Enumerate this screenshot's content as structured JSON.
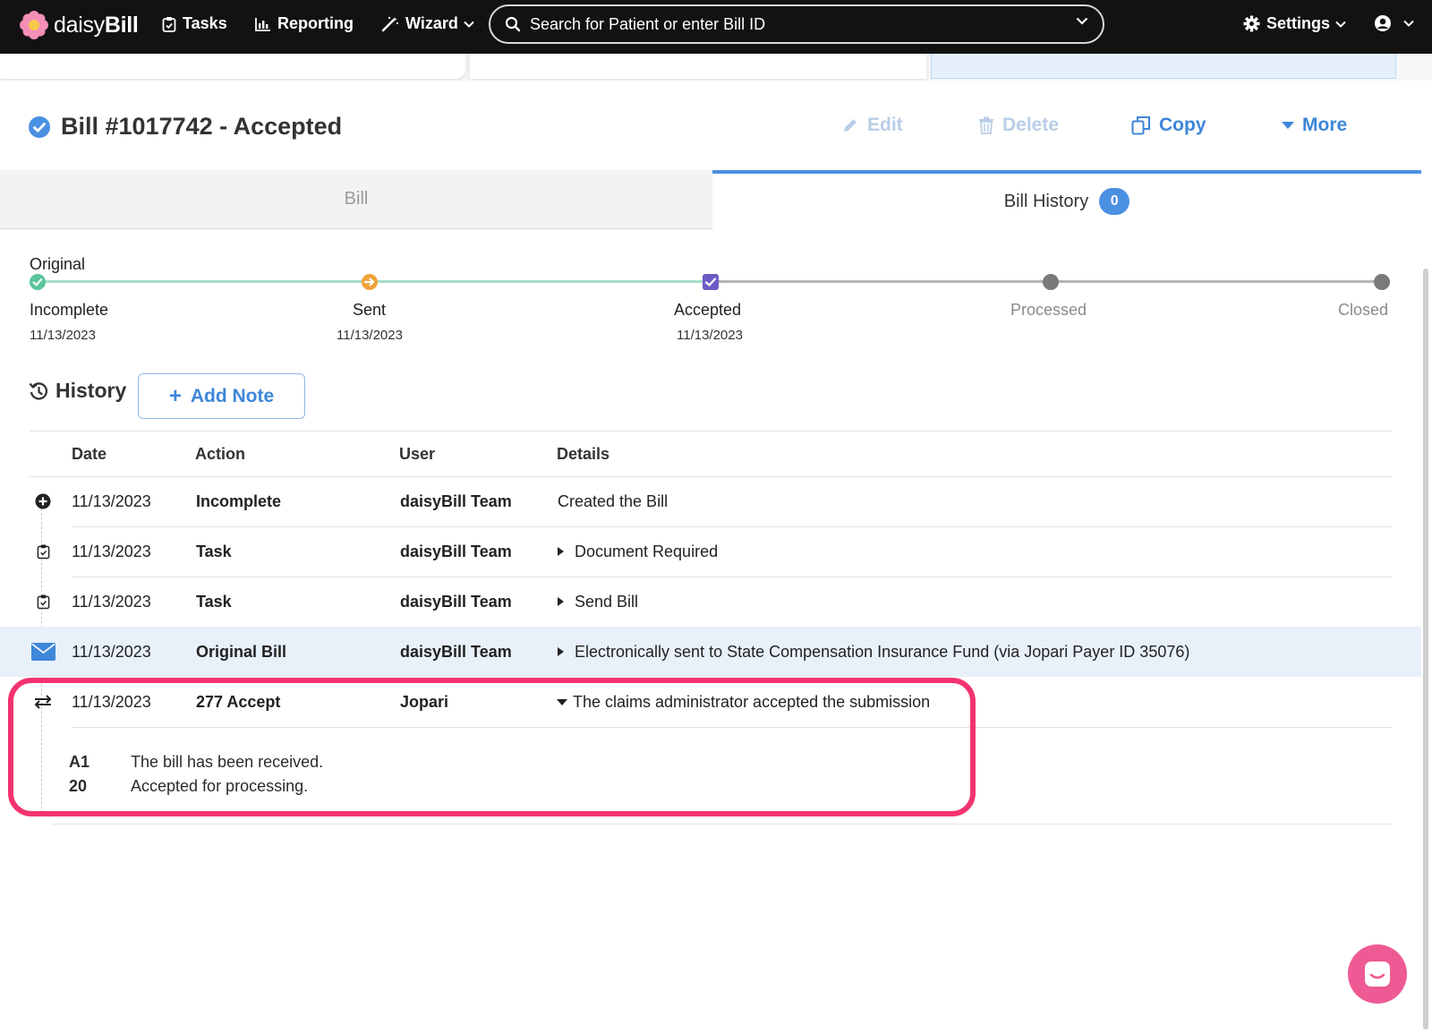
{
  "app": {
    "brand_light": "daisy",
    "brand_bold": "Bill",
    "colors": {
      "accent": "#4a90e2",
      "highlight": "#f3336f",
      "chat": "#ee5a93",
      "progress_done": "#a8dcc6",
      "progress_todo": "#b5b5b5"
    }
  },
  "nav": {
    "tasks": "Tasks",
    "reporting": "Reporting",
    "wizard": "Wizard",
    "search_placeholder": "Search for Patient or enter Bill ID",
    "settings": "Settings"
  },
  "bill": {
    "title": "Bill #1017742 - Accepted",
    "actions": {
      "edit": "Edit",
      "delete": "Delete",
      "copy": "Copy",
      "more": "More"
    }
  },
  "tabs": {
    "bill": "Bill",
    "history": "Bill History",
    "history_count": "0"
  },
  "progress": {
    "label": "Original",
    "steps": [
      {
        "label": "Incomplete",
        "date": "11/13/2023",
        "status": "done"
      },
      {
        "label": "Sent",
        "date": "11/13/2023",
        "status": "done"
      },
      {
        "label": "Accepted",
        "date": "11/13/2023",
        "status": "current"
      },
      {
        "label": "Processed",
        "date": "",
        "status": "pending"
      },
      {
        "label": "Closed",
        "date": "",
        "status": "pending"
      }
    ]
  },
  "history": {
    "title": "History",
    "add_note": "Add Note",
    "columns": [
      "Date",
      "Action",
      "User",
      "Details"
    ],
    "rows": [
      {
        "icon": "plus-circle-icon",
        "date": "11/13/2023",
        "action": "Incomplete",
        "user": "daisyBill Team",
        "details": "Created the Bill"
      },
      {
        "icon": "clipboard-check-icon",
        "date": "11/13/2023",
        "action": "Task",
        "user": "daisyBill Team",
        "details": "Document Required"
      },
      {
        "icon": "clipboard-check-icon",
        "date": "11/13/2023",
        "action": "Task",
        "user": "daisyBill Team",
        "details": "Send Bill"
      },
      {
        "icon": "envelope-icon",
        "date": "11/13/2023",
        "action": "Original Bill",
        "user": "daisyBill Team",
        "details": "Electronically sent to State Compensation Insurance Fund (via Jopari Payer ID 35076)"
      },
      {
        "icon": "exchange-arrows-icon",
        "date": "11/13/2023",
        "action": "277 Accept",
        "user": "Jopari",
        "details": "The claims administrator accepted the submission"
      }
    ],
    "codes": [
      {
        "code": "A1",
        "text": "The bill has been received."
      },
      {
        "code": "20",
        "text": "Accepted for processing."
      }
    ]
  }
}
